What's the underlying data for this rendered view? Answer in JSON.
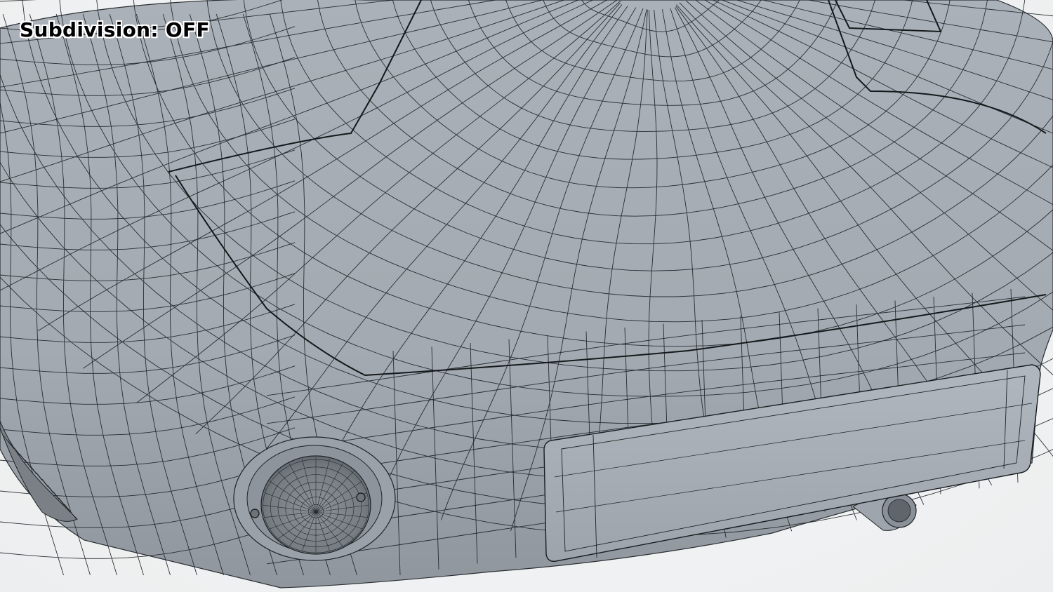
{
  "viewport": {
    "overlay_label": "Subdivision: OFF",
    "render_mode": "wireframe-on-shaded",
    "subject": "car-front-3d-model",
    "colors": {
      "background": "#f1f2f3",
      "surface": "#a6adb4",
      "surface_shadow": "#8e959c",
      "wire": "#1c2024",
      "headlight_glass": "#7f858b",
      "plate": "#a9b0b7"
    }
  }
}
